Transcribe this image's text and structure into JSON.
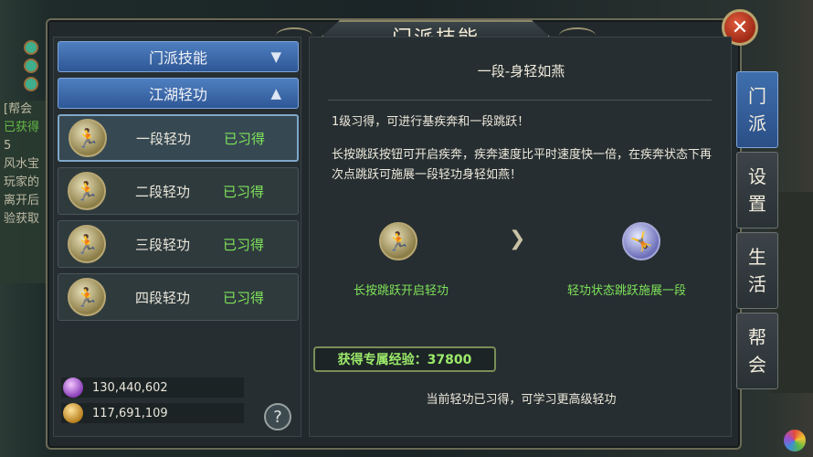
{
  "window": {
    "title": "门派技能",
    "close_glyph": "✕"
  },
  "world": {
    "left_lines": [
      "[帮会",
      "已获得",
      "5",
      "风水宝",
      "玩家的",
      "离开后",
      "验获取"
    ]
  },
  "categories": [
    {
      "label": "门派技能",
      "chevron": "▼"
    },
    {
      "label": "江湖轻功",
      "chevron": "▲"
    }
  ],
  "skills": [
    {
      "name": "一段轻功",
      "state": "已习得",
      "selected": true
    },
    {
      "name": "二段轻功",
      "state": "已习得",
      "selected": false
    },
    {
      "name": "三段轻功",
      "state": "已习得",
      "selected": false
    },
    {
      "name": "四段轻功",
      "state": "已习得",
      "selected": false
    }
  ],
  "currency": [
    {
      "icon": "purple-gem-icon",
      "value": "130,440,602"
    },
    {
      "icon": "gold-ingot-icon",
      "value": "117,691,109"
    }
  ],
  "help_glyph": "?",
  "detail": {
    "title": "一段-身轻如燕",
    "para1": "1级习得，可进行基疾奔和一段跳跃！",
    "para2": "长按跳跃按钮可开启疾奔，疾奔速度比平时速度快一倍，在疾奔状态下再次点跳跃可施展一段轻功身轻如燕！",
    "step1_label": "长按跳跃开启轻功",
    "step2_label": "轻功状态跳跃施展一段",
    "arrow": "❯",
    "exp_label": "获得专属经验：37800",
    "note": "当前轻功已习得，可学习更高级轻功"
  },
  "tabs": [
    {
      "label": "门派",
      "chars": [
        "门",
        "派"
      ],
      "active": true
    },
    {
      "label": "设置",
      "chars": [
        "设",
        "置"
      ],
      "active": false
    },
    {
      "label": "生活",
      "chars": [
        "生",
        "活"
      ],
      "active": false
    },
    {
      "label": "帮会",
      "chars": [
        "帮",
        "会"
      ],
      "active": false
    }
  ],
  "colors": {
    "accent_blue": "#3f6fae",
    "learned_green": "#7fe35a",
    "exp_green": "#9cea6a",
    "close_red": "#c9401f"
  }
}
